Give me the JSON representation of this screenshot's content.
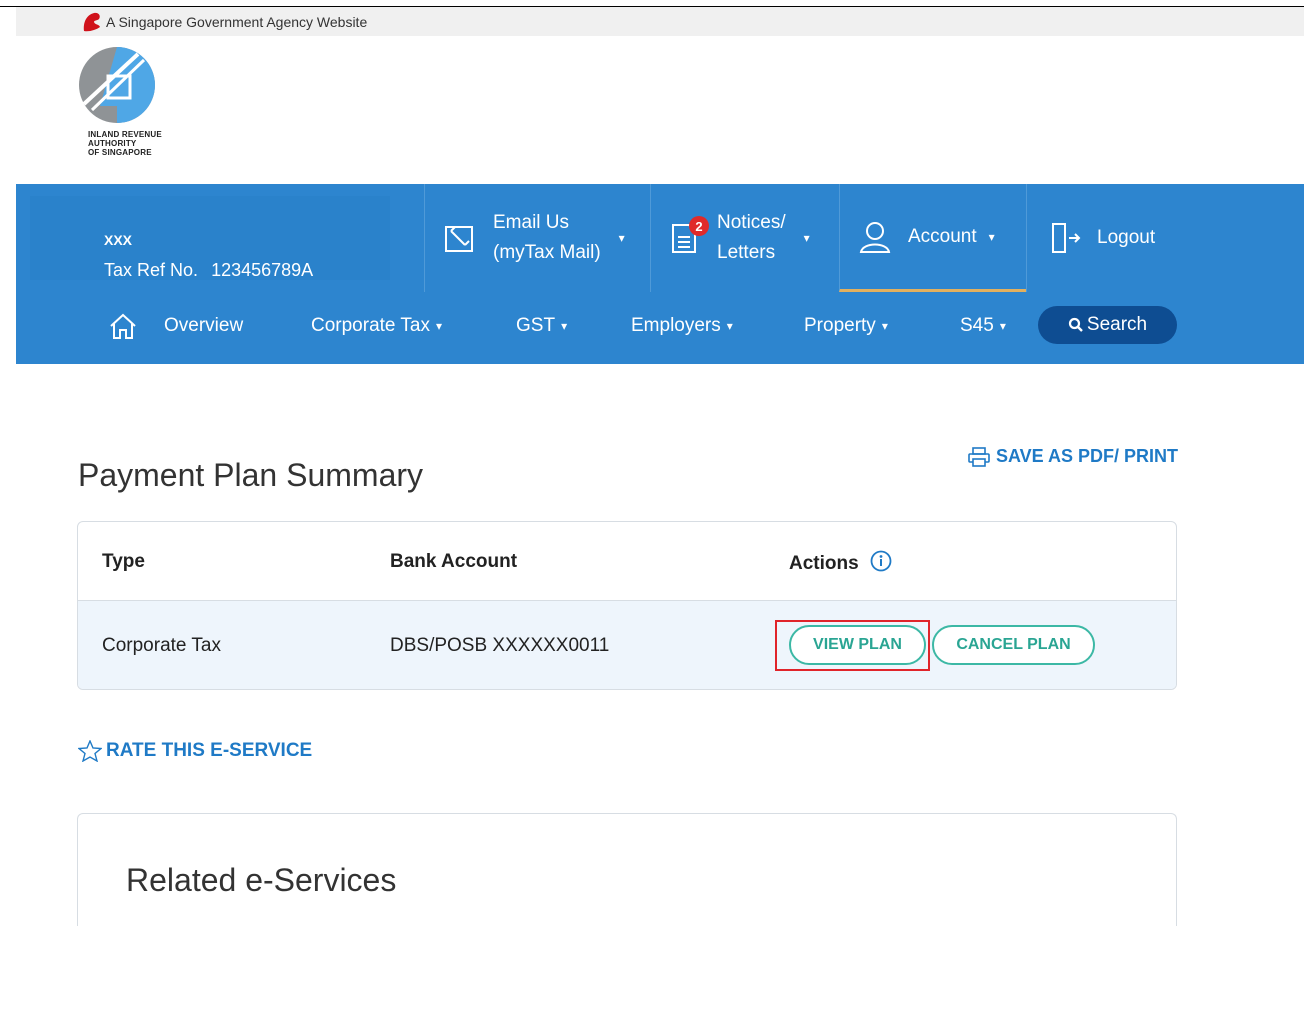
{
  "gov_banner": {
    "text": "A Singapore Government Agency Website",
    "icon": "lion-head-icon"
  },
  "logo": {
    "line1": "INLAND REVENUE",
    "line2": "AUTHORITY",
    "line3": "OF SINGAPORE"
  },
  "user": {
    "name": "XXX",
    "tax_ref_label": "Tax Ref No.",
    "tax_ref_value": "123456789A"
  },
  "header_actions": {
    "email": {
      "line1": "Email Us",
      "line2": "(myTax Mail)",
      "caret": "▾"
    },
    "notices": {
      "line1": "Notices/",
      "line2": "Letters",
      "badge": "2",
      "caret": "▾"
    },
    "account": {
      "label": "Account",
      "caret": "▾"
    },
    "logout": {
      "label": "Logout"
    }
  },
  "nav": {
    "overview": "Overview",
    "corporate_tax": "Corporate Tax",
    "gst": "GST",
    "employers": "Employers",
    "property": "Property",
    "s45": "S45",
    "arrow": "▾",
    "search": "Search"
  },
  "page": {
    "title": "Payment Plan Summary",
    "save_pdf": "SAVE AS PDF/ PRINT",
    "rate": "RATE THIS E-SERVICE",
    "related_title": "Related e-Services"
  },
  "table": {
    "headers": {
      "type": "Type",
      "bank": "Bank Account",
      "actions": "Actions"
    },
    "rows": [
      {
        "type": "Corporate Tax",
        "bank": "DBS/POSB XXXXXX0011",
        "view": "VIEW PLAN",
        "cancel": "CANCEL PLAN"
      }
    ]
  },
  "colors": {
    "primary_blue": "#2d85cf",
    "dark_blue": "#0e4d92",
    "teal": "#3cb8a5",
    "link_blue": "#1f7ac6",
    "badge_red": "#e02a2a",
    "highlight_red": "#e0242a"
  }
}
